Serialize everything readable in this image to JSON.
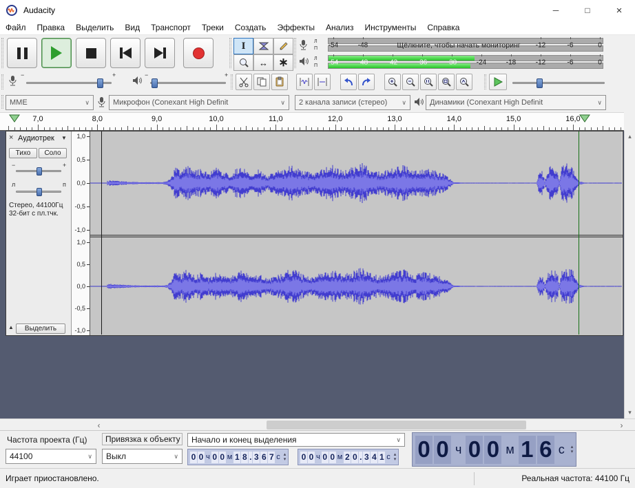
{
  "window": {
    "title": "Audacity",
    "minimize": "─",
    "maximize": "□",
    "close": "×"
  },
  "menu": {
    "items": [
      "Файл",
      "Правка",
      "Выделить",
      "Вид",
      "Транспорт",
      "Треки",
      "Создать",
      "Эффекты",
      "Анализ",
      "Инструменты",
      "Справка"
    ]
  },
  "icons": {
    "combo_arrow": "∨",
    "track_close": "×",
    "track_menu": "▼",
    "track_collapse": "▲",
    "scroll_left": "‹",
    "scroll_right": "›",
    "scroll_up": "▴",
    "scroll_down": "▾",
    "spin_up": "▴",
    "spin_down": "▾",
    "minus": "−",
    "plus": "+",
    "tool_selection": "I",
    "tool_timeshift": "↔",
    "tool_multi": "∗"
  },
  "meters": {
    "record": {
      "channel_left": "Л",
      "channel_right": "П",
      "hint": "Щёлкните, чтобы начать мониторинг",
      "labels": [
        "-54",
        "-48",
        "-12",
        "-6",
        "0"
      ]
    },
    "play": {
      "channel_left": "Л",
      "channel_right": "П",
      "labels": [
        "-54",
        "-48",
        "-42",
        "-36",
        "-30",
        "-24",
        "-18",
        "-12",
        "-6",
        "0"
      ]
    }
  },
  "devices": {
    "host": "MME",
    "input": "Микрофон (Conexant High Definit",
    "channels": "2 канала записи (стерео)",
    "output": "Динамики (Conexant High Definit"
  },
  "timeline": {
    "labels": [
      "7,0",
      "8,0",
      "9,0",
      "10,0",
      "11,0",
      "12,0",
      "13,0",
      "14,0",
      "15,0",
      "16,0"
    ]
  },
  "track": {
    "name": "Аудиотрек",
    "mute_label": "Тихо",
    "solo_label": "Соло",
    "info_line1": "Стерео, 44100Гц",
    "info_line2": "32-бит с пл.тчк.",
    "select_label": "Выделить",
    "pan_left": "л",
    "pan_right": "п",
    "ruler_labels": [
      "1,0",
      "0,5",
      "0,0",
      "-0,5",
      "-1,0"
    ]
  },
  "bottom": {
    "rate_label": "Частота проекта (Гц)",
    "rate_value": "44100",
    "snap_label": "Привязка к объекту",
    "snap_value": "Выкл",
    "selection_label": "Начало и конец выделения",
    "unit_hours": "ч",
    "unit_minutes": "м",
    "unit_seconds": "с",
    "selection_start": {
      "hours": "00",
      "minutes": "00",
      "seconds": "18.367"
    },
    "selection_end": {
      "hours": "00",
      "minutes": "00",
      "seconds": "20.341"
    },
    "position": {
      "hours": "00",
      "minutes": "00",
      "seconds": "16"
    }
  },
  "status": {
    "left": "Играет приостановлено.",
    "right": "Реальная частота: 44100 Гц"
  },
  "waveform": {
    "envelope": [
      [
        0,
        0
      ],
      [
        21,
        0
      ],
      [
        24,
        0
      ],
      [
        25,
        0.05
      ],
      [
        30,
        0.06
      ],
      [
        40,
        0.05
      ],
      [
        55,
        0.03
      ],
      [
        75,
        0.02
      ],
      [
        105,
        0.02
      ],
      [
        112,
        0.04
      ],
      [
        117,
        0.12
      ],
      [
        124,
        0.38
      ],
      [
        131,
        0.3
      ],
      [
        140,
        0.44
      ],
      [
        150,
        0.28
      ],
      [
        162,
        0.34
      ],
      [
        172,
        0.22
      ],
      [
        182,
        0.36
      ],
      [
        192,
        0.28
      ],
      [
        202,
        0.2
      ],
      [
        212,
        0.32
      ],
      [
        222,
        0.4
      ],
      [
        232,
        0.24
      ],
      [
        245,
        0.32
      ],
      [
        258,
        0.18
      ],
      [
        270,
        0.26
      ],
      [
        282,
        0.36
      ],
      [
        295,
        0.44
      ],
      [
        308,
        0.3
      ],
      [
        322,
        0.22
      ],
      [
        336,
        0.34
      ],
      [
        352,
        0.42
      ],
      [
        366,
        0.3
      ],
      [
        380,
        0.36
      ],
      [
        396,
        0.46
      ],
      [
        410,
        0.3
      ],
      [
        424,
        0.26
      ],
      [
        440,
        0.36
      ],
      [
        456,
        0.42
      ],
      [
        470,
        0.28
      ],
      [
        484,
        0.36
      ],
      [
        498,
        0.3
      ],
      [
        512,
        0.22
      ],
      [
        521,
        0.12
      ],
      [
        528,
        0.02
      ],
      [
        545,
        0.01
      ],
      [
        648,
        0.01
      ],
      [
        651,
        0.2
      ],
      [
        656,
        0.3
      ],
      [
        660,
        0.06
      ],
      [
        665,
        0.32
      ],
      [
        671,
        0.44
      ],
      [
        678,
        0.36
      ],
      [
        681,
        0.06
      ],
      [
        685,
        0.4
      ],
      [
        692,
        0.46
      ],
      [
        700,
        0.42
      ],
      [
        706,
        0.16
      ],
      [
        710,
        0.04
      ],
      [
        718,
        0.01
      ],
      [
        772,
        0.01
      ]
    ]
  }
}
